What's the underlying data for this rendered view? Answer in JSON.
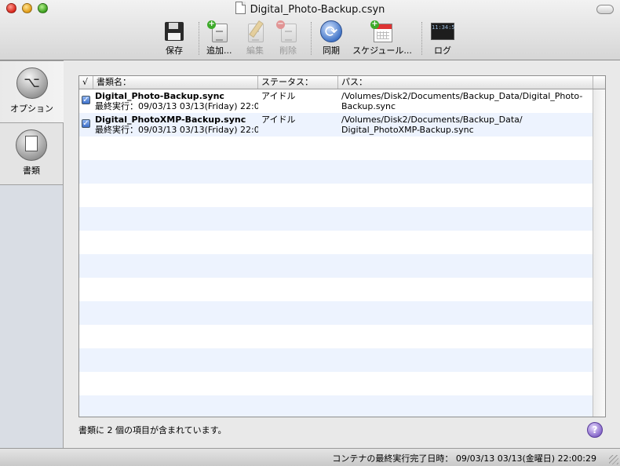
{
  "window": {
    "title": "Digital_Photo-Backup.csyn"
  },
  "toolbar": {
    "save": "保存",
    "add": "追加...",
    "edit": "編集",
    "delete": "削除",
    "sync": "同期",
    "schedule": "スケジュール...",
    "log": "ログ",
    "log_screen_text": "11:34:5"
  },
  "sidebar": {
    "options": "オプション",
    "documents": "書類"
  },
  "table": {
    "columns": {
      "check": "√",
      "name": "書類名：",
      "status": "ステータス：",
      "path": "パス："
    },
    "rows": [
      {
        "name": "Digital_Photo-Backup.sync",
        "last_run": "最終実行：09/03/13 03/13(Friday) 22:00:0",
        "status": "アイドル",
        "path_line1": "/Volumes/Disk2/Documents/Backup_Data/Digital_Photo-",
        "path_line2": "Backup.sync",
        "checked": true
      },
      {
        "name": "Digital_PhotoXMP-Backup.sync",
        "last_run": "最終実行：09/03/13 03/13(Friday) 22:00:2",
        "status": "アイドル",
        "path_line1": "/Volumes/Disk2/Documents/Backup_Data/",
        "path_line2": "Digital_PhotoXMP-Backup.sync",
        "checked": true
      }
    ]
  },
  "footer": {
    "count_text": "書類に 2 個の項目が含まれています。",
    "help": "?"
  },
  "status_bar": {
    "text": "コンテナの最終実行完了日時： 09/03/13 03/13(金曜日) 22:00:29"
  }
}
